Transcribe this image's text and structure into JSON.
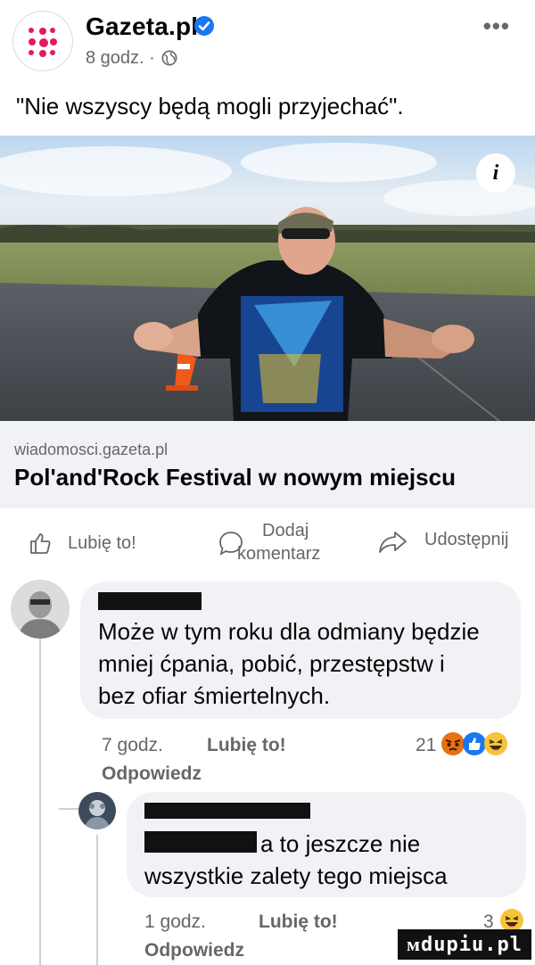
{
  "post": {
    "page_name": "Gazeta.pl",
    "time": "8 godz. ·",
    "text": "\"Nie wszyscy będą mogli przyjechać\"."
  },
  "link": {
    "domain": "wiadomosci.gazeta.pl",
    "title": "Pol'and'Rock Festival w nowym miejscu",
    "info_icon_label": "i"
  },
  "actions": {
    "like": "Lubię to!",
    "comment_line1": "Dodaj",
    "comment_line2": "komentarz",
    "share": "Udostępnij"
  },
  "comments": [
    {
      "text_lines": [
        "Może w tym roku dla odmiany będzie",
        "mniej ćpania, pobić, przestępstw i",
        "bez ofiar śmiertelnych."
      ],
      "time": "7 godz.",
      "like_label": "Lubię to!",
      "reply_label": "Odpowiedz",
      "reaction_count": "21",
      "reactions": [
        "angry-emoji",
        "like-emoji",
        "haha-emoji"
      ]
    },
    {
      "text_lines": [
        "a to jeszcze nie",
        "wszystkie zalety tego miejsca"
      ],
      "time": "1 godz.",
      "like_label": "Lubię to!",
      "reply_label": "Odpowiedz",
      "reaction_count": "3",
      "reactions": [
        "haha-emoji"
      ]
    }
  ],
  "watermark": "ᴍdupiu.pl",
  "colors": {
    "accent": "#1877f2",
    "brand_pink": "#e5195f",
    "meta_gray": "#65676b",
    "bubble": "#f0f2f5"
  }
}
